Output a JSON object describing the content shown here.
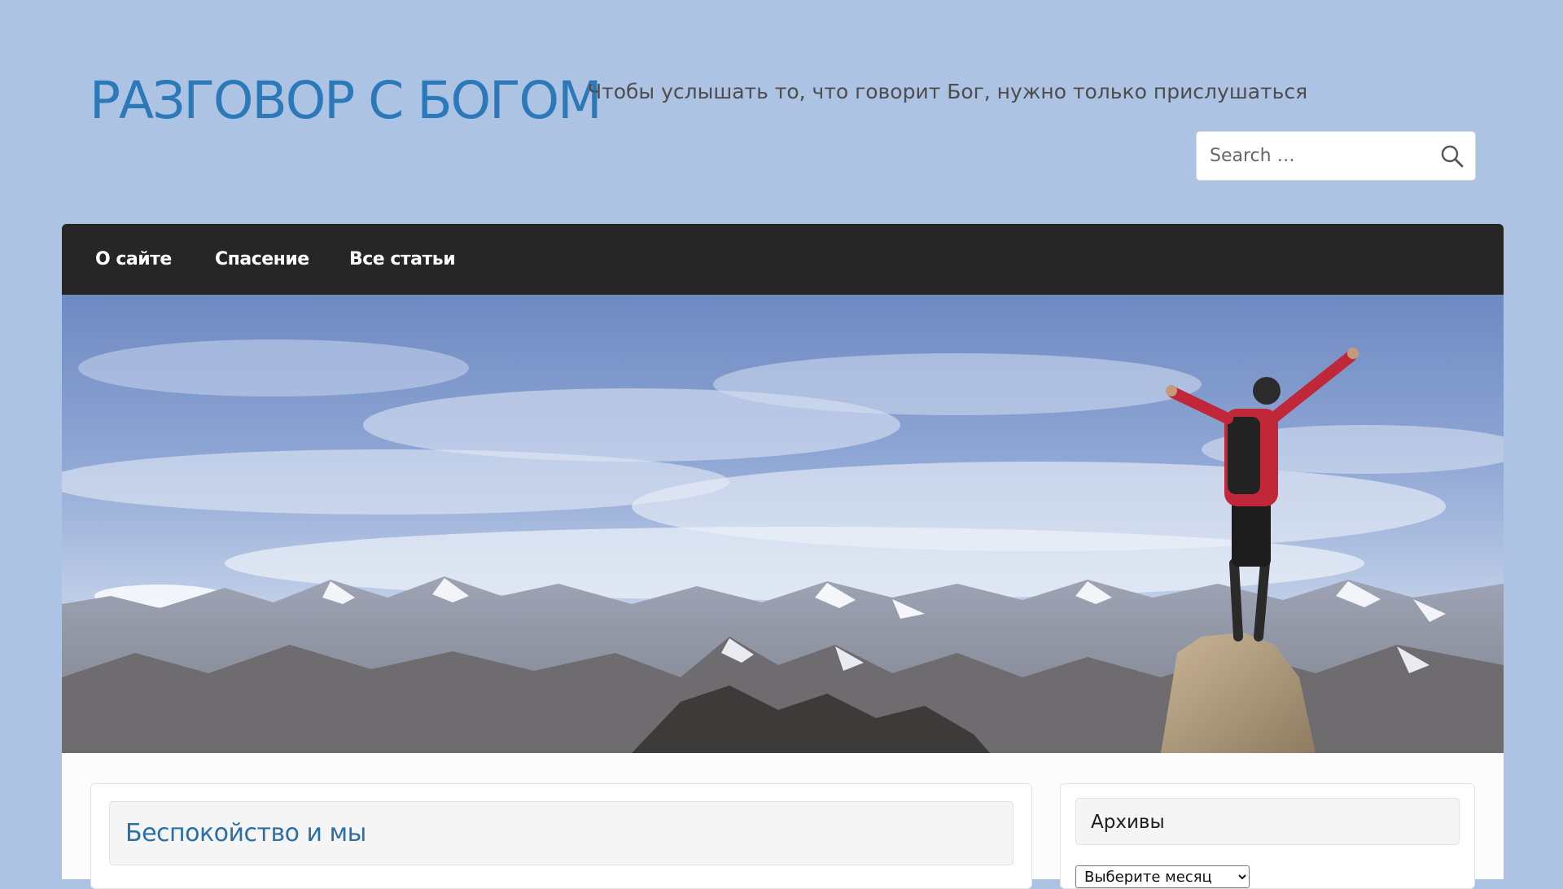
{
  "header": {
    "site_title": "РАЗГОВОР С БОГОМ",
    "tagline": "Чтобы услышать то, что говорит Бог, нужно только прислушаться"
  },
  "search": {
    "placeholder": "Search …",
    "icon": "search-icon"
  },
  "nav": {
    "items": [
      {
        "label": "О сайте"
      },
      {
        "label": "Спасение"
      },
      {
        "label": "Все статьи"
      }
    ]
  },
  "hero": {
    "image": "hiker-on-mountain-peak"
  },
  "main": {
    "post_title": "Беспокойство и мы"
  },
  "sidebar": {
    "archives_title": "Архивы",
    "archives_select_value": "Выберите месяц"
  },
  "colors": {
    "page_background": "#adc3e3",
    "title_color": "#2b79b8",
    "nav_background": "#262626"
  }
}
